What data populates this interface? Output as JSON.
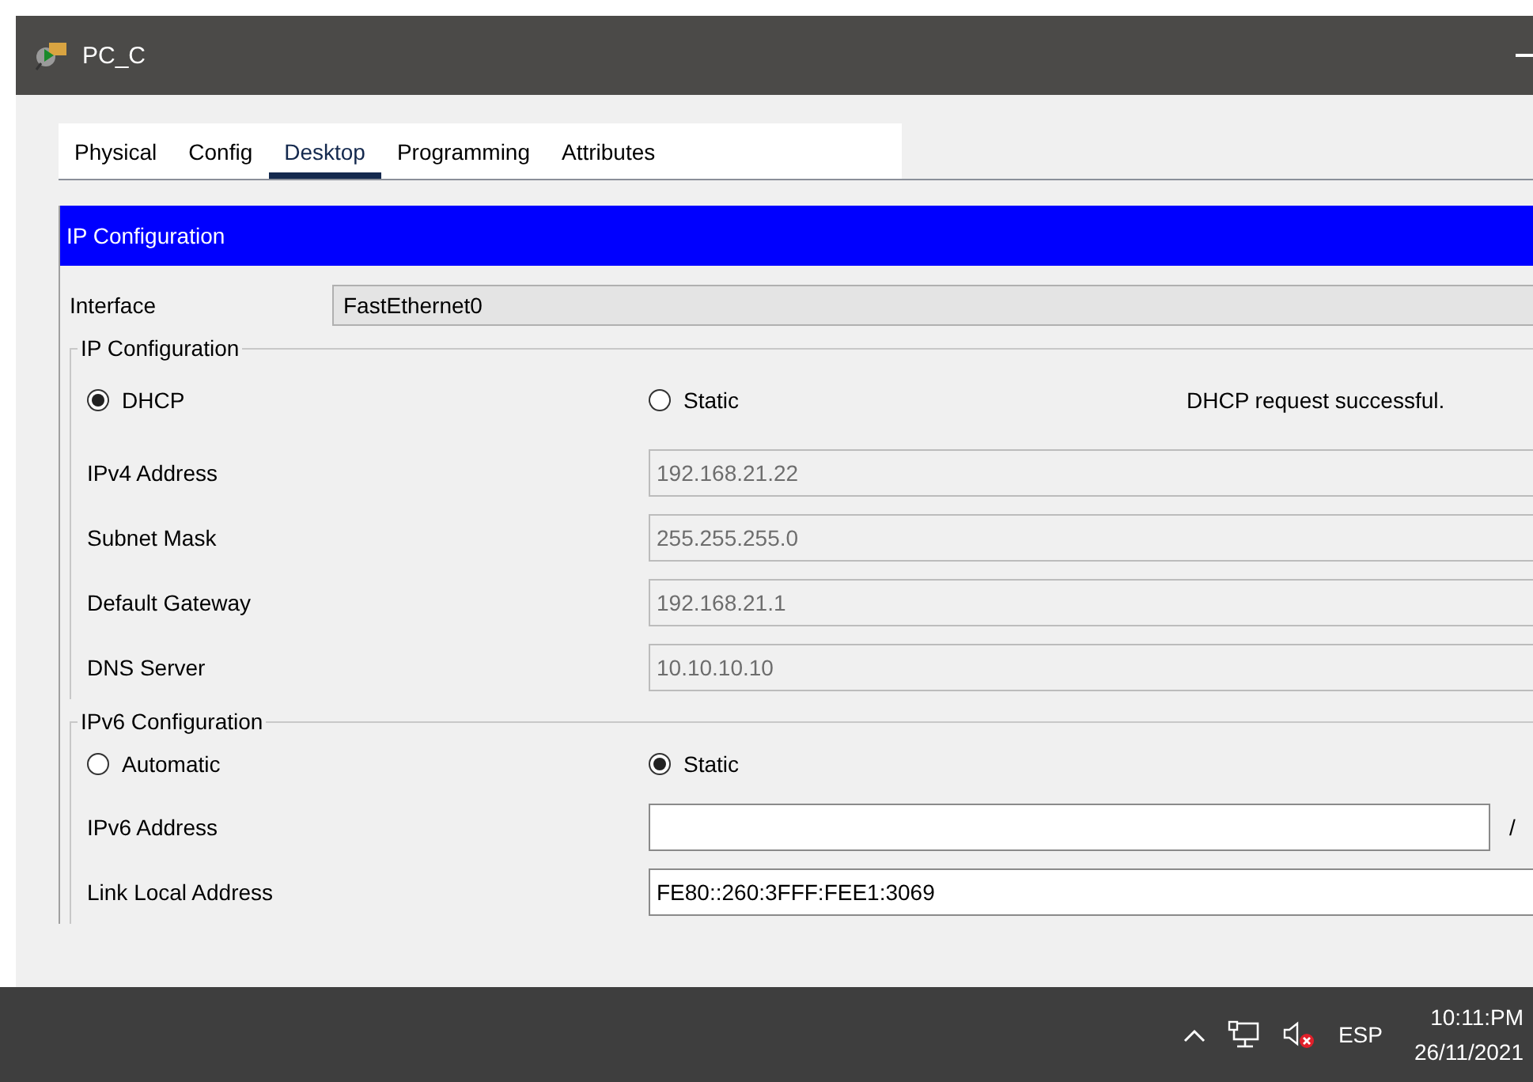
{
  "window": {
    "title": "PC_C"
  },
  "tabs": [
    {
      "label": "Physical",
      "selected": false
    },
    {
      "label": "Config",
      "selected": false
    },
    {
      "label": "Desktop",
      "selected": true
    },
    {
      "label": "Programming",
      "selected": false
    },
    {
      "label": "Attributes",
      "selected": false
    }
  ],
  "panel_title": "IP Configuration",
  "interface": {
    "label": "Interface",
    "value": "FastEthernet0"
  },
  "ipv4": {
    "legend": "IP Configuration",
    "modes": [
      {
        "label": "DHCP",
        "selected": true
      },
      {
        "label": "Static",
        "selected": false
      }
    ],
    "status": "DHCP request successful.",
    "fields": [
      {
        "label": "IPv4 Address",
        "value": "192.168.21.22",
        "disabled": true
      },
      {
        "label": "Subnet Mask",
        "value": "255.255.255.0",
        "disabled": true
      },
      {
        "label": "Default Gateway",
        "value": "192.168.21.1",
        "disabled": true
      },
      {
        "label": "DNS Server",
        "value": "10.10.10.10",
        "disabled": true
      }
    ]
  },
  "ipv6": {
    "legend": "IPv6 Configuration",
    "modes": [
      {
        "label": "Automatic",
        "selected": false
      },
      {
        "label": "Static",
        "selected": true
      }
    ],
    "fields": [
      {
        "label": "IPv6 Address",
        "disabled": false,
        "suffix": "/"
      },
      {
        "label": "Link Local Address",
        "value": "FE80::260:3FFF:FEE1:3069",
        "disabled": false
      }
    ]
  },
  "taskbar": {
    "language": "ESP",
    "time": "10:11:PM",
    "date": "26/11/2021"
  }
}
